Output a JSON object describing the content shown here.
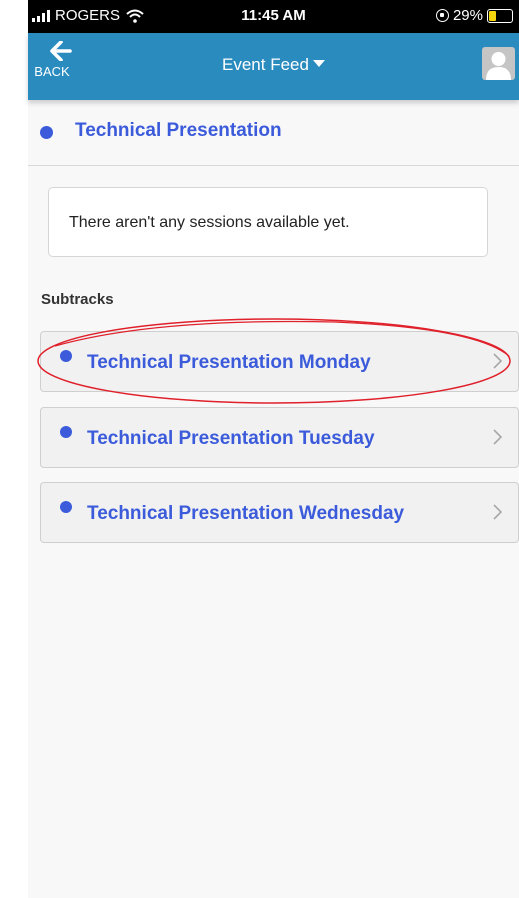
{
  "status_bar": {
    "carrier": "ROGERS",
    "time": "11:45 AM",
    "battery_percent": "29%",
    "battery_level": 0.29,
    "battery_color": "#f5d60a"
  },
  "header": {
    "back_label": "BACK",
    "title": "Event Feed",
    "background": "#2a8bbf",
    "back_icon": "arrow-left-icon",
    "avatar_icon": "user-icon"
  },
  "track": {
    "title": "Technical Presentation",
    "dot_color": "#3b5bdb"
  },
  "empty_message": "There aren't any sessions available yet.",
  "subtracks": {
    "label": "Subtracks",
    "items": [
      {
        "label": "Technical Presentation Monday",
        "highlighted": true
      },
      {
        "label": "Technical Presentation Tuesday",
        "highlighted": false
      },
      {
        "label": "Technical Presentation Wednesday",
        "highlighted": false
      }
    ]
  },
  "annotation": {
    "shape": "ellipse",
    "color": "#e0202a"
  }
}
